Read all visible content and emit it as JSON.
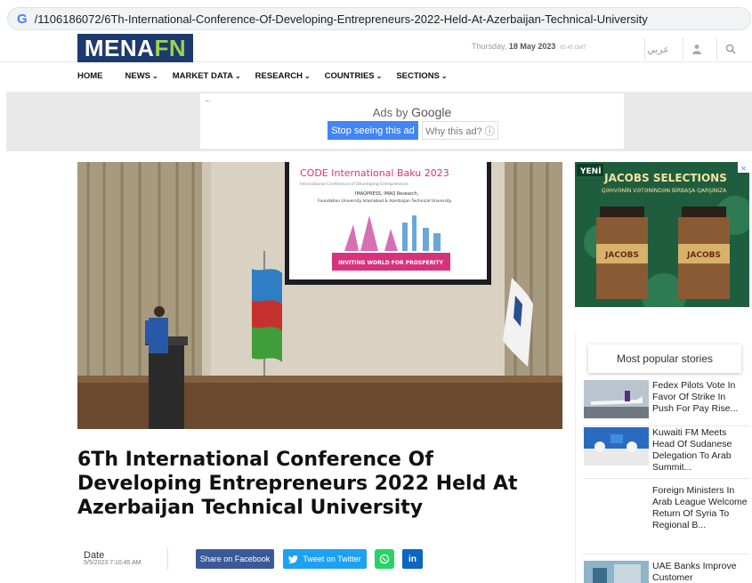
{
  "browser": {
    "url": "/1106186072/6Th-International-Conference-Of-Developing-Entrepreneurs-2022-Held-At-Azerbaijan-Technical-University",
    "favicon": "G"
  },
  "header": {
    "logo_part1": "MENA",
    "logo_part2": "FN",
    "date_day": "Thursday,",
    "date_value": "18 May 2023",
    "date_time": "05:45 GMT",
    "arabic_label": "عربي",
    "user_icon": "user-icon",
    "search_icon": "search-icon"
  },
  "nav": {
    "items": [
      {
        "label": "HOME",
        "has_dropdown": false
      },
      {
        "label": "NEWS",
        "has_dropdown": true
      },
      {
        "label": "MARKET DATA",
        "has_dropdown": true
      },
      {
        "label": "RESEARCH",
        "has_dropdown": true
      },
      {
        "label": "COUNTRIES",
        "has_dropdown": true
      },
      {
        "label": "SECTIONS",
        "has_dropdown": true
      }
    ],
    "chevron": "⌄"
  },
  "ad": {
    "ads_by": "Ads by",
    "google": "Google",
    "stop_label": "Stop seeing this ad",
    "why_label": "Why this ad? ⓘ"
  },
  "hero": {
    "screen_title": "CODE International Baku 2023",
    "screen_subtitle": "International Conference of Developing Entrepreneurs",
    "screen_org1": "IMAQPRESS, IMAQ Research,",
    "screen_org2": "Foundation University Islamabad & Azerbaijan Technical University",
    "screen_banner": "INVITING WORLD FOR PROSPERITY"
  },
  "side_ad": {
    "badge": "YENİ",
    "headline": "JACOBS SELECTIONS",
    "subline": "QƏHVƏNİN VƏTƏNİNDƏN BİRBAŞA QARŞINIZA",
    "brand": "JACOBS",
    "close_icon": "close-icon"
  },
  "popular": {
    "title": "Most popular stories",
    "items": [
      {
        "text": "Fedex Pilots Vote In Favor Of Strike In Push For Pay Rise..."
      },
      {
        "text": "Kuwaiti FM Meets Head Of Sudanese Delegation To Arab Summit..."
      },
      {
        "text": "Foreign Ministers In Arab League Welcome Return Of Syria To Regional B..."
      },
      {
        "text": "UAE Banks Improve Customer"
      }
    ]
  },
  "article": {
    "title": "6Th International Conference Of Developing Entrepreneurs 2022 Held At Azerbaijan Technical University",
    "date_label": "Date",
    "date_value": "5/5/2023 7:10:45 AM"
  },
  "share": {
    "facebook": "Share on Facebook",
    "twitter": "Tweet on Twitter",
    "whatsapp_icon": "whatsapp-icon",
    "linkedin": "in"
  },
  "colors": {
    "brand_navy": "#1d3a6e",
    "brand_green": "#9bd34e",
    "facebook": "#3b5998",
    "twitter": "#1da1f2",
    "whatsapp": "#25d366",
    "linkedin": "#0a66c2"
  }
}
